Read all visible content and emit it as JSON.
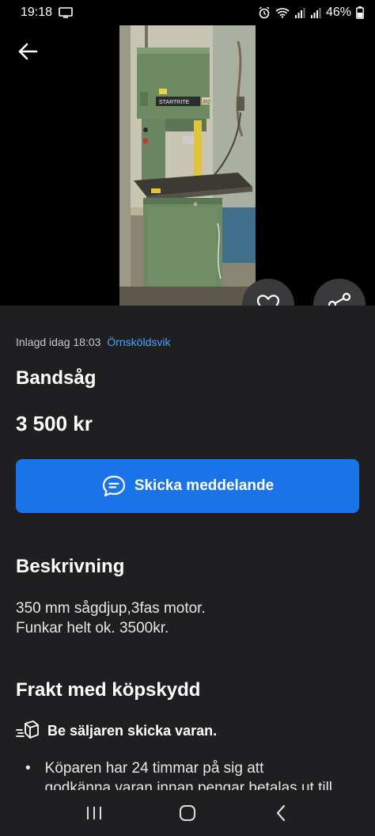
{
  "status_bar": {
    "time": "19:18",
    "battery": "46%"
  },
  "listing": {
    "posted": "Inlagd idag 18:03",
    "location": "Örnsköldsvik",
    "title": "Bandsåg",
    "price": "3 500 kr",
    "photo_label": "STARTRITE",
    "photo_model": "352"
  },
  "cta": {
    "label": "Skicka meddelande"
  },
  "description": {
    "heading": "Beskrivning",
    "line1": "350 mm sågdjup,3fas motor.",
    "line2": "Funkar helt ok. 3500kr."
  },
  "shipping": {
    "heading": "Frakt med köpskydd",
    "subheading": "Be säljaren skicka varan.",
    "bullet1_line1": "Köparen har 24 timmar på sig att",
    "bullet1_line2": "godkänna varan innan pengar betalas ut till"
  },
  "icons": {
    "back": "arrow-left-icon",
    "favorite": "heart-icon",
    "share": "share-icon",
    "chat": "chat-bubble-icon",
    "shipping": "package-icon"
  },
  "colors": {
    "accent": "#1a73e8",
    "link": "#4aa3ff",
    "background": "#1f1f21",
    "fab": "#3a3a3c"
  }
}
